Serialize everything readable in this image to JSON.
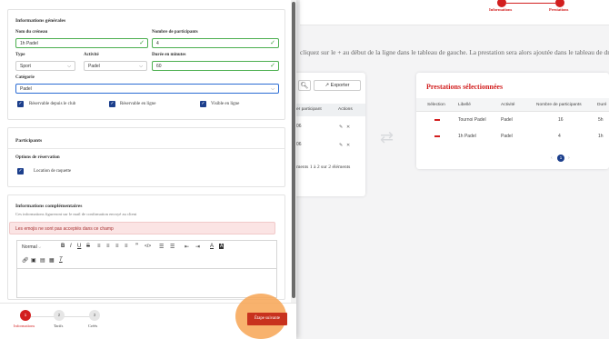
{
  "background": {
    "steps": [
      {
        "label": "Informations"
      },
      {
        "label": "Prestations"
      }
    ],
    "instruction": "cliquez sur le + au début de la ligne dans le tableau de gauche. La prestation sera alors ajoutée dans le tableau de droite. Vo",
    "left_table": {
      "export_label": "Exporter",
      "columns": [
        "er participant",
        "Actions"
      ],
      "rows": [
        {
          "col1": "06"
        },
        {
          "col1": "06"
        }
      ],
      "footer": "ments 1 à 2 sur 2 éléments"
    },
    "right_table": {
      "title": "Prestations sélectionnées",
      "columns": [
        "Sélection",
        "Libellé",
        "Activité",
        "Nombre de participants",
        "Duré"
      ],
      "rows": [
        {
          "libelle": "Tournoi Padel",
          "activite": "Padel",
          "participants": "16",
          "duree": "5h"
        },
        {
          "libelle": "1h Padel",
          "activite": "Padel",
          "participants": "4",
          "duree": "1h"
        }
      ],
      "page": "1"
    },
    "accent_color": "#d21f1f"
  },
  "form": {
    "general": {
      "title": "Informations générales",
      "nom_label": "Nom du créneau",
      "nom_value": "1h Padel",
      "participants_label": "Nombre de participants",
      "participants_value": "4",
      "type_label": "Type",
      "type_value": "Sport",
      "activite_label": "Activité",
      "activite_value": "Padel",
      "duree_label": "Durée en minutes",
      "duree_value": "60",
      "categorie_label": "Catégorie",
      "categorie_value": "Padel",
      "checkboxes": [
        {
          "label": "Réservable depuis le club"
        },
        {
          "label": "Réservable en ligne"
        },
        {
          "label": "Visible en ligne"
        }
      ]
    },
    "participants": {
      "title": "Participants",
      "options_label": "Options de réservation",
      "option": "Location de raquette"
    },
    "complementary": {
      "title": "Informations complémentaires",
      "subtitle": "Ces informations figureront sur le mail de confirmation envoyé au client",
      "alert": "Les emojis ne sont pas acceptés dans ce champ",
      "toolbar_format": "Normal"
    }
  },
  "wizard": {
    "steps": [
      {
        "number": "1",
        "label": "Informations"
      },
      {
        "number": "2",
        "label": "Tarifs"
      },
      {
        "number": "3",
        "label": "Créés"
      }
    ],
    "next_label": "Étape suivante"
  }
}
